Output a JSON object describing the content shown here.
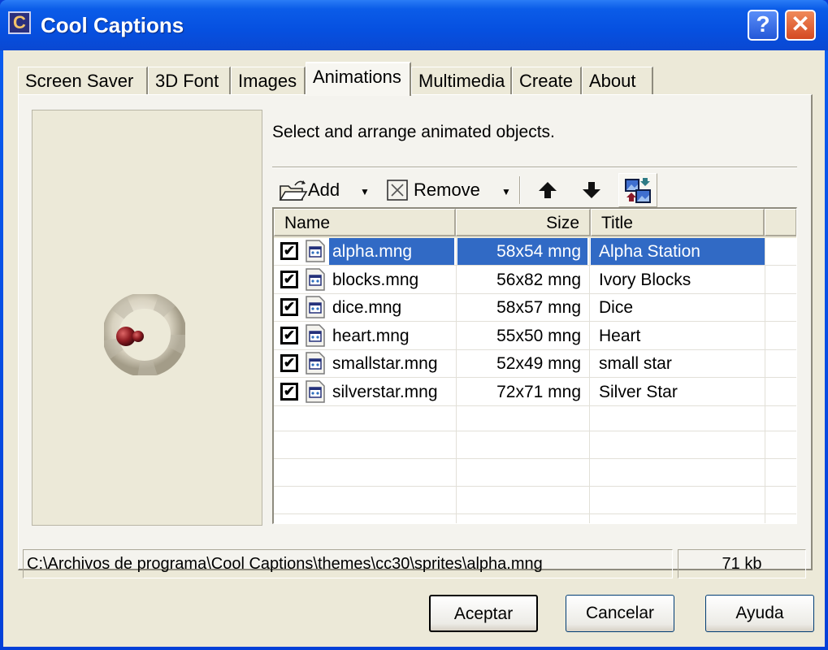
{
  "window": {
    "title": "Cool Captions",
    "app_icon_glyph": "C",
    "help_glyph": "?",
    "close_glyph": "✕"
  },
  "tabs": [
    {
      "label": "Screen Saver",
      "active": false
    },
    {
      "label": "3D Font",
      "active": false
    },
    {
      "label": "Images",
      "active": false
    },
    {
      "label": "Animations",
      "active": true
    },
    {
      "label": "Multimedia",
      "active": false
    },
    {
      "label": "Create",
      "active": false
    },
    {
      "label": "About",
      "active": false
    }
  ],
  "panel": {
    "instructions": "Select and arrange animated objects."
  },
  "toolbar": {
    "add_label": "Add",
    "remove_label": "Remove",
    "dropdown_glyph": "▼",
    "move_up_glyph": "🡅",
    "move_down_glyph": "🡇"
  },
  "list": {
    "columns": [
      "Name",
      "Size",
      "Title"
    ],
    "rows": [
      {
        "checked": true,
        "name": "alpha.mng",
        "size": "58x54 mng",
        "title": "Alpha Station",
        "selected": true
      },
      {
        "checked": true,
        "name": "blocks.mng",
        "size": "56x82 mng",
        "title": "Ivory Blocks",
        "selected": false
      },
      {
        "checked": true,
        "name": "dice.mng",
        "size": "58x57 mng",
        "title": "Dice",
        "selected": false
      },
      {
        "checked": true,
        "name": "heart.mng",
        "size": "55x50 mng",
        "title": "Heart",
        "selected": false
      },
      {
        "checked": true,
        "name": "smallstar.mng",
        "size": "52x49 mng",
        "title": "small star",
        "selected": false
      },
      {
        "checked": true,
        "name": "silverstar.mng",
        "size": "72x71 mng",
        "title": "Silver Star",
        "selected": false
      }
    ],
    "check_glyph": "✔"
  },
  "statusbar": {
    "path": "C:\\Archivos de programa\\Cool Captions\\themes\\cc30\\sprites\\alpha.mng",
    "size": "71 kb"
  },
  "buttons": {
    "ok": "Aceptar",
    "cancel": "Cancelar",
    "help": "Ayuda"
  },
  "colors": {
    "selection": "#316ac5",
    "titlebar": "#0650e0",
    "face": "#ece9d8"
  }
}
